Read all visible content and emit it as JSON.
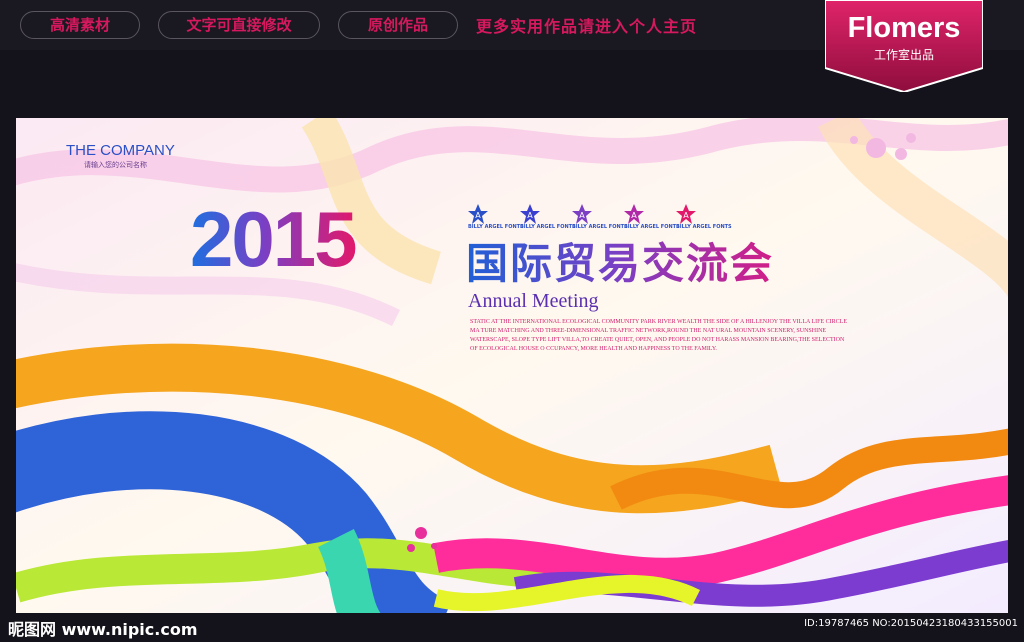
{
  "top_bar": {
    "tags": [
      "高清素材",
      "文字可直接修改",
      "原创作品"
    ],
    "promo": "更多实用作品请进入个人主页",
    "brand": "Flomers",
    "brand_sub": "工作室出品"
  },
  "poster": {
    "company": "THE COMPANY",
    "company_sub": "请输入您的公司名称",
    "year": "2015",
    "star_letter": "A",
    "star_caption": "BILLY ARGEL FONTS",
    "title_cn": "国际贸易交流会",
    "title_en": "Annual Meeting",
    "description": "STATIC AT THE INTERNATIONAL ECOLOGICAL COMMUNITY PARK RIVER WEALTH THE SIDE OF A HILLENJOY THE VILLA LIFE CIRCLE MA TURE MATCHING AND THREE-DIMENSIONAL TRAFFIC NETWORK,ROUND THE NAT URAL MOUNTAIN SCENERY, SUNSHINE WATERSCAPE, SLOPE TYPE LIFT VILLA,TO CREATE QUIET, OPEN, AND PEOPLE DO NOT HARASS MANSION BEARING,THE SELECTION OF ECOLOGICAL HOUSE O CCUPANCY, MORE HEALTH AND HAPPINESS TO THE FAMILY."
  },
  "footer": {
    "watermark": "昵图网 www.nipic.com",
    "id": "ID:19787465 NO:20150423180433155001"
  },
  "colors": {
    "pink": "#d6195f",
    "blue": "#2a4fc7",
    "orange": "#f58c1e",
    "green": "#9be13a",
    "purple": "#7b3fc4"
  }
}
